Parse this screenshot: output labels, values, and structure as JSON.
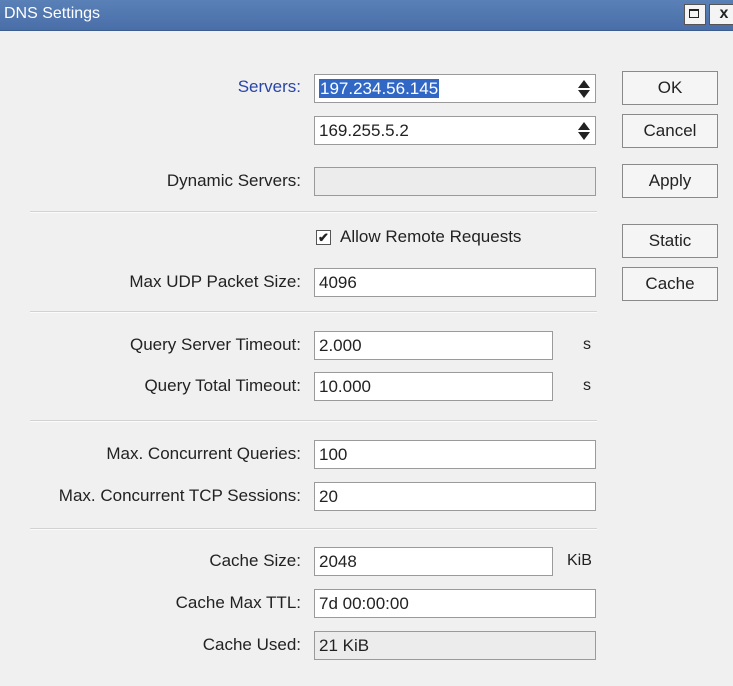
{
  "window": {
    "title": "DNS Settings",
    "close_glyph": "x"
  },
  "servers": {
    "label": "Servers:",
    "values": [
      "197.234.56.145",
      "169.255.5.2"
    ]
  },
  "dynamic_servers": {
    "label": "Dynamic Servers:",
    "value": ""
  },
  "allow_remote": {
    "label": "Allow Remote Requests",
    "checked": true,
    "mark": "✔"
  },
  "max_udp": {
    "label": "Max UDP Packet Size:",
    "value": "4096"
  },
  "query_server_timeout": {
    "label": "Query Server Timeout:",
    "value": "2.000",
    "unit": "s"
  },
  "query_total_timeout": {
    "label": "Query Total Timeout:",
    "value": "10.000",
    "unit": "s"
  },
  "max_concurrent_queries": {
    "label": "Max. Concurrent Queries:",
    "value": "100"
  },
  "max_tcp_sessions": {
    "label": "Max. Concurrent TCP Sessions:",
    "value": "20"
  },
  "cache_size": {
    "label": "Cache Size:",
    "value": "2048",
    "unit": "KiB"
  },
  "cache_max_ttl": {
    "label": "Cache Max TTL:",
    "value": "7d 00:00:00"
  },
  "cache_used": {
    "label": "Cache Used:",
    "value": "21 KiB"
  },
  "buttons": {
    "ok": "OK",
    "cancel": "Cancel",
    "apply": "Apply",
    "static": "Static",
    "cache": "Cache"
  }
}
